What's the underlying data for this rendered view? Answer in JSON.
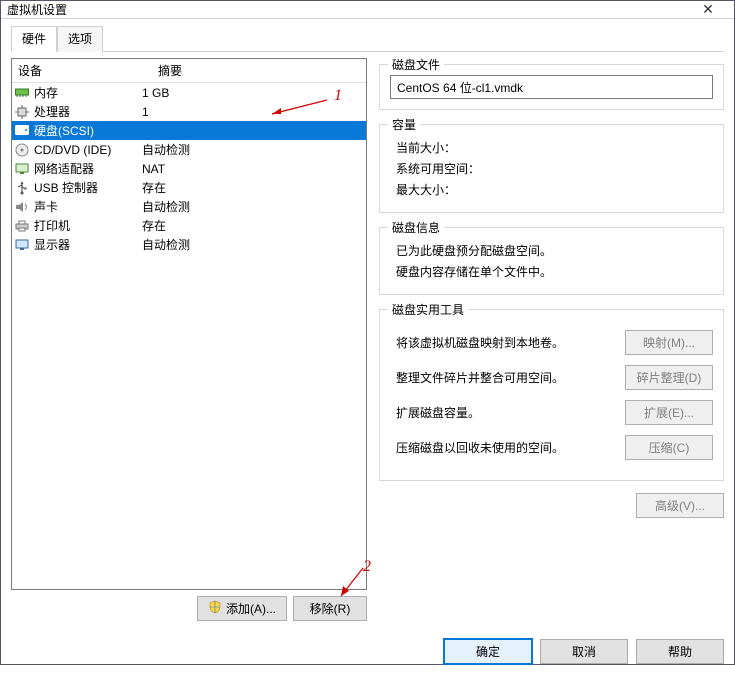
{
  "window": {
    "title": "虚拟机设置",
    "close_glyph": "✕"
  },
  "tabs": {
    "hardware": "硬件",
    "options": "选项"
  },
  "device_table": {
    "header_device": "设备",
    "header_summary": "摘要",
    "rows": [
      {
        "label": "内存",
        "summary": "1 GB",
        "icon": "memory"
      },
      {
        "label": "处理器",
        "summary": "1",
        "icon": "cpu"
      },
      {
        "label": "硬盘(SCSI)",
        "summary": "",
        "icon": "disk",
        "selected": true
      },
      {
        "label": "CD/DVD (IDE)",
        "summary": "自动检测",
        "icon": "cd"
      },
      {
        "label": "网络适配器",
        "summary": "NAT",
        "icon": "nic"
      },
      {
        "label": "USB 控制器",
        "summary": "存在",
        "icon": "usb"
      },
      {
        "label": "声卡",
        "summary": "自动检测",
        "icon": "sound"
      },
      {
        "label": "打印机",
        "summary": "存在",
        "icon": "printer"
      },
      {
        "label": "显示器",
        "summary": "自动检测",
        "icon": "display"
      }
    ]
  },
  "left_buttons": {
    "add": "添加(A)...",
    "remove": "移除(R)"
  },
  "annotations": {
    "one": "1",
    "two": "2"
  },
  "disk_file": {
    "legend": "磁盘文件",
    "value": "CentOS 64 位-cl1.vmdk"
  },
  "capacity": {
    "legend": "容量",
    "current_size_label": "当前大小：",
    "free_space_label": "系统可用空间：",
    "max_size_label": "最大大小："
  },
  "disk_info": {
    "legend": "磁盘信息",
    "line1": "已为此硬盘预分配磁盘空间。",
    "line2": "硬盘内容存储在单个文件中。"
  },
  "utilities": {
    "legend": "磁盘实用工具",
    "map_desc": "将该虚拟机磁盘映射到本地卷。",
    "map_btn": "映射(M)...",
    "defrag_desc": "整理文件碎片并整合可用空间。",
    "defrag_btn": "碎片整理(D)",
    "expand_desc": "扩展磁盘容量。",
    "expand_btn": "扩展(E)...",
    "compact_desc": "压缩磁盘以回收未使用的空间。",
    "compact_btn": "压缩(C)"
  },
  "advanced_btn": "高级(V)...",
  "bottom": {
    "ok": "确定",
    "cancel": "取消",
    "help": "帮助"
  }
}
